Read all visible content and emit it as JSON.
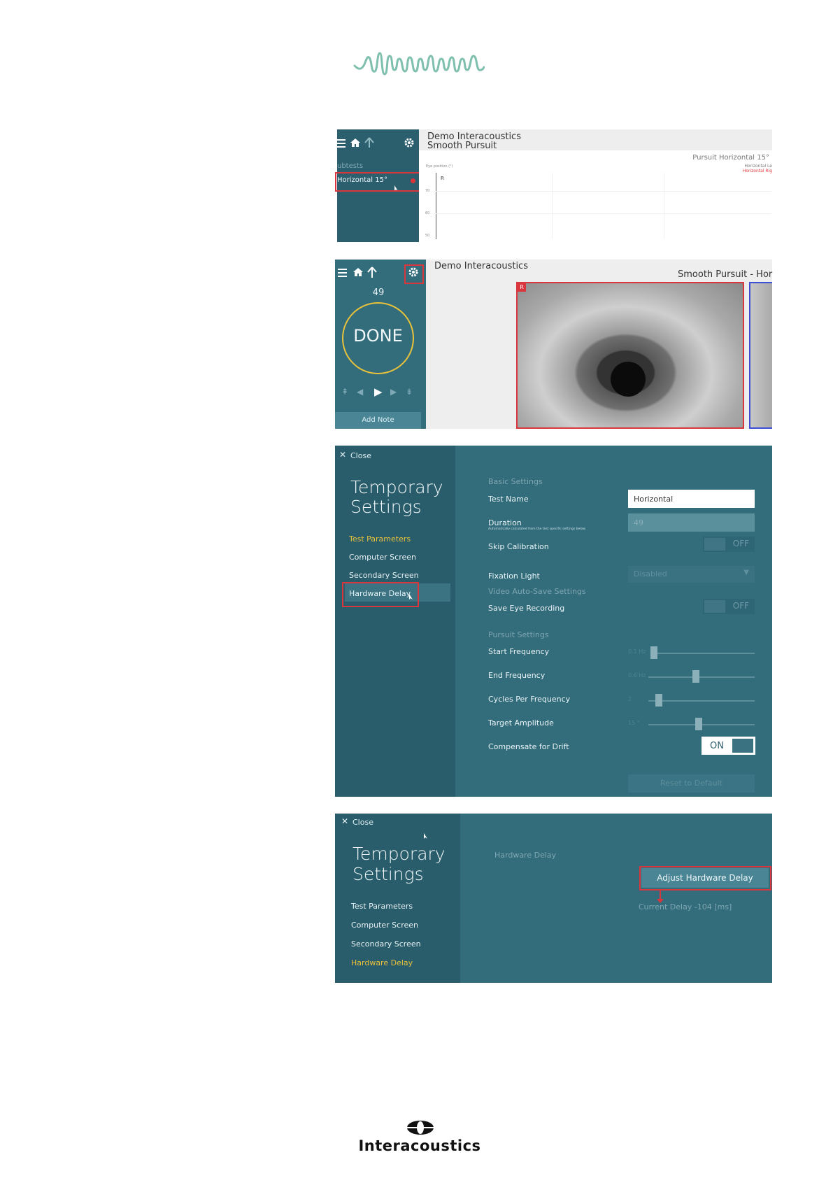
{
  "footer": {
    "brand": "Interacoustics"
  },
  "panel1": {
    "subtests_label": "ubtests",
    "item_label": "Horizontal 15°",
    "title_line1": "Demo Interacoustics",
    "title_line2": "Smooth Pursuit",
    "chart_label": "Pursuit Horizontal 15°",
    "legend1": "Horizontal Le",
    "legend2": "Horizontal Rig",
    "axis_caption": "Eye position (°)",
    "r_label": "R",
    "ticks": [
      "70",
      "60",
      "50"
    ]
  },
  "panel2": {
    "title": "Demo Interacoustics",
    "subtitle": "Smooth Pursuit - Hor",
    "count": "49",
    "status": "DONE",
    "add_note": "Add Note",
    "eye_marker": "R"
  },
  "panel3": {
    "close": "Close",
    "heading_line1": "Temporary",
    "heading_line2": "Settings",
    "nav": [
      "Test Parameters",
      "Computer Screen",
      "Secondary Screen",
      "Hardware Delay"
    ],
    "basic_settings": "Basic Settings",
    "test_name_label": "Test Name",
    "test_name_value": "Horizontal",
    "duration_label": "Duration",
    "duration_note": "Automatically calculated from the test specific settings below.",
    "duration_value": "49",
    "skip_calibration": "Skip Calibration",
    "off1": "OFF",
    "fixation_light": "Fixation Light",
    "fixation_value": "Disabled",
    "video_section": "Video Auto-Save Settings",
    "save_eye_recording": "Save Eye Recording",
    "off2": "OFF",
    "pursuit_settings": "Pursuit Settings",
    "start_frequency": "Start Frequency",
    "start_frequency_value": "0.1 Hz",
    "end_frequency": "End Frequency",
    "end_frequency_value": "0.6 Hz",
    "cycles": "Cycles Per Frequency",
    "cycles_value": "2",
    "target_amplitude": "Target Amplitude",
    "target_amplitude_value": "15 °",
    "compensate": "Compensate for Drift",
    "on": "ON",
    "reset": "Reset to Default"
  },
  "panel4": {
    "close": "Close",
    "heading_line1": "Temporary",
    "heading_line2": "Settings",
    "nav": [
      "Test Parameters",
      "Computer Screen",
      "Secondary Screen",
      "Hardware Delay"
    ],
    "section": "Hardware Delay",
    "adjust_button": "Adjust Hardware Delay",
    "current_delay": "Current Delay -104 [ms]"
  },
  "colors": {
    "teal_dark": "#2b5f6e",
    "teal": "#336d7c",
    "highlight": "#d9363e",
    "active": "#e8c23a"
  }
}
